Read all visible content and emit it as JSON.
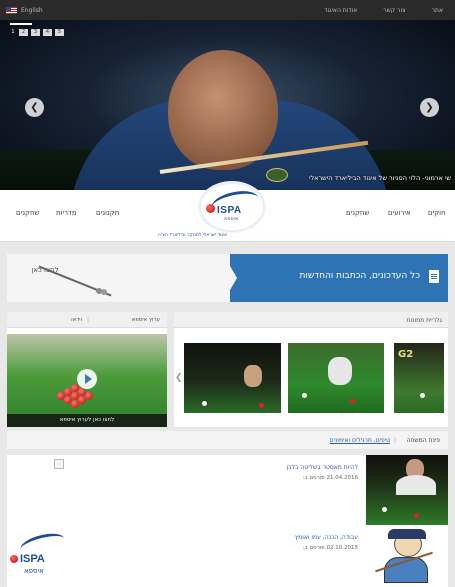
{
  "topbar": {
    "language": "English",
    "links": [
      "אודות האיגוד",
      "צור קשר",
      "אתר"
    ]
  },
  "hero": {
    "slide_current": "1",
    "slide_pages": [
      "2",
      "3",
      "4",
      "5"
    ],
    "caption": "שי ארמוני- הלוי הסניור של איגוד הביליארד הישראלי"
  },
  "nav": {
    "right_items": [
      "חוקים",
      "אירועים",
      "שחקנים"
    ],
    "left_items": [
      "תקנונים",
      "מדריות",
      "שחקנים"
    ],
    "logo_text": "ISPA",
    "logo_hebrew": "איספא",
    "tagline": "איגוד ישראלי לסנוקר וביליארד הצ'ה"
  },
  "news": {
    "title": "כל העדכונים, הכתבות והחדשות",
    "cta": "לחצו כאן"
  },
  "gallery": {
    "header": "גלריית תמונות",
    "thumb_text": "G2"
  },
  "video": {
    "header_a": "וידאו",
    "header_b": "ערוץ איספא",
    "caption": "לחצו כאן לערוץ איספא"
  },
  "tags": {
    "label": "פינת המשחה",
    "link": "טיפים, תרגילים ואימונים"
  },
  "articles": [
    {
      "headline": "להיות מאסטר בשליטה בלבן",
      "date": "21.04.2016 פורסם ב:"
    },
    {
      "headline": "עבודה, הכנה, עמו ואומץ",
      "date": "02.10.2015 פורסם ב:"
    }
  ],
  "footer_logo": {
    "text": "ISPA",
    "hebrew": "איספא"
  }
}
